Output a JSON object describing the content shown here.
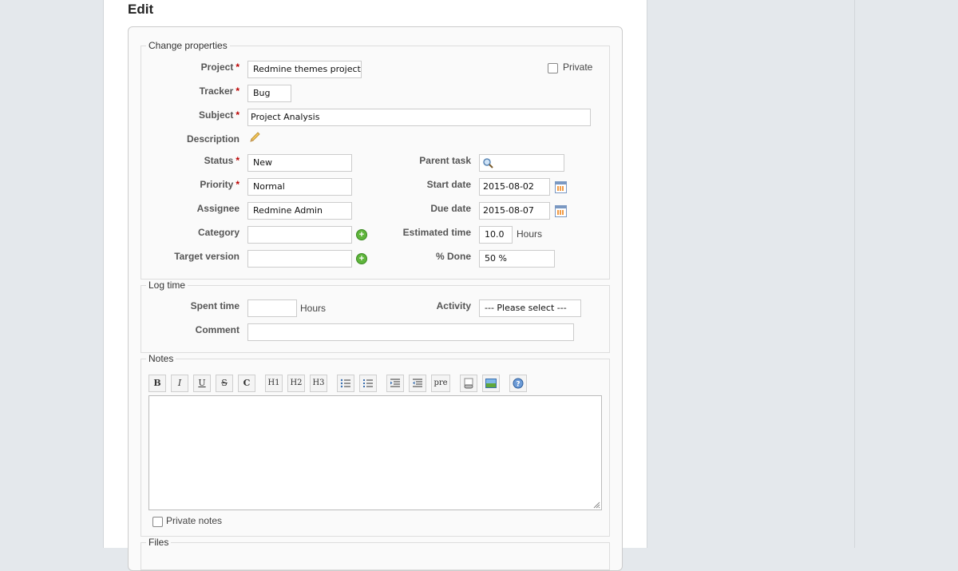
{
  "page": {
    "title": "Edit"
  },
  "properties": {
    "legend": "Change properties",
    "project": {
      "label": "Project",
      "value": "Redmine themes project"
    },
    "private": {
      "label": "Private"
    },
    "tracker": {
      "label": "Tracker",
      "value": "Bug"
    },
    "subject": {
      "label": "Subject",
      "value": "Project Analysis"
    },
    "description": {
      "label": "Description",
      "edit_icon": "pencil-icon"
    },
    "status": {
      "label": "Status",
      "value": "New"
    },
    "priority": {
      "label": "Priority",
      "value": "Normal"
    },
    "assignee": {
      "label": "Assignee",
      "value": "Redmine Admin"
    },
    "category": {
      "label": "Category",
      "value": ""
    },
    "target_version": {
      "label": "Target version",
      "value": ""
    },
    "parent_task": {
      "label": "Parent task",
      "value": ""
    },
    "start_date": {
      "label": "Start date",
      "value": "2015-08-02"
    },
    "due_date": {
      "label": "Due date",
      "value": "2015-08-07"
    },
    "estimated_time": {
      "label": "Estimated time",
      "value": "10.0",
      "unit": "Hours"
    },
    "done": {
      "label": "% Done",
      "value": "50 %"
    },
    "required_marker": "*"
  },
  "log_time": {
    "legend": "Log time",
    "spent_time": {
      "label": "Spent time",
      "value": "",
      "unit": "Hours"
    },
    "activity": {
      "label": "Activity",
      "value": "--- Please select ---"
    },
    "comment": {
      "label": "Comment",
      "value": ""
    }
  },
  "notes": {
    "legend": "Notes",
    "toolbar": {
      "bold": "B",
      "italic": "I",
      "underline": "U",
      "strike": "S",
      "code": "C",
      "h1": "H1",
      "h2": "H2",
      "h3": "H3",
      "pre": "pre"
    },
    "private_notes": {
      "label": "Private notes"
    }
  },
  "files": {
    "legend": "Files"
  },
  "colors": {
    "required": "#bb0000",
    "add_green": "#5fb53b",
    "calendar_blue": "#7a98c2"
  }
}
